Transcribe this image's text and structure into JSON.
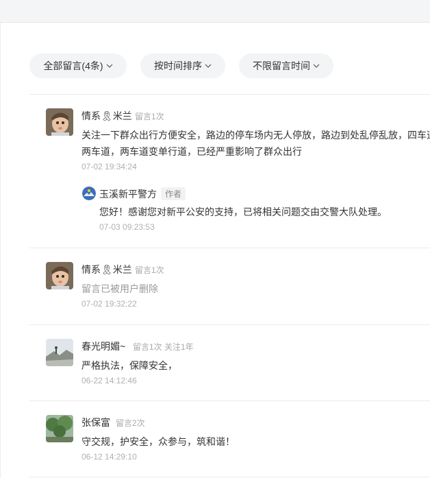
{
  "filters": {
    "all_comments": "全部留言(4条)",
    "sort": "按时间排序",
    "time_range": "不限留言时间"
  },
  "comments": [
    {
      "name": "情系🎗米兰",
      "meta": "留言1次",
      "content_line1": "关注一下群众出行方便安全，路边的停车场内无人停放，路边到处乱停乱放，四车道",
      "content_line2": "两车道，两车道变单行道，已经严重影响了群众出行",
      "time": "07-02 19:34:24",
      "reply": {
        "name": "玉溪新平警方",
        "badge": "作者",
        "content": "您好！感谢您对新平公安的支持，已将相关问题交由交警大队处理。",
        "time": "07-03 09:23:53"
      }
    },
    {
      "name": "情系🎗米兰",
      "meta": "留言1次",
      "content": "留言已被用户删除",
      "time": "07-02 19:32:22"
    },
    {
      "name": "春光明媚~",
      "meta": "留言1次 关注1年",
      "content": "严格执法，保障安全，",
      "time": "06-22 14:12:46"
    },
    {
      "name": "张保富",
      "meta": "留言2次",
      "content": "守交规，护安全，众参与，筑和谐！",
      "time": "06-12 14:29:10"
    }
  ]
}
